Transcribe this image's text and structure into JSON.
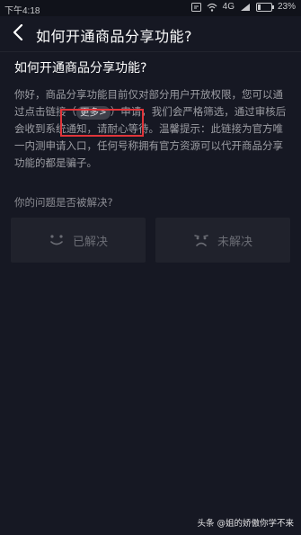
{
  "status_bar": {
    "time": "下午4:18",
    "network": "4G",
    "battery": "23%",
    "battery_level": 0.23
  },
  "header": {
    "back_icon": "chevron-left-icon",
    "title": "如何开通商品分享功能?"
  },
  "article": {
    "title": "如何开通商品分享功能?",
    "body_before_link": "你好，商品分享功能目前仅对部分用户开放权限，您可以通过点击链接（",
    "link_label": "更多>",
    "body_after_link": "）申请，我们会严格筛选，通过审核后会收到系统通知，请耐心等待。温馨提示：此链接为官方唯一内测申请入口，任何号称拥有官方资源可以代开商品分享功能的都是骗子。"
  },
  "feedback": {
    "question": "你的问题是否被解决?",
    "resolved_label": "已解决",
    "resolved_icon": "smile-icon",
    "unresolved_label": "未解决",
    "unresolved_icon": "frown-icon"
  },
  "colors": {
    "background": "#161823",
    "highlight_box": "#e0353a"
  },
  "watermark": "头条 @姐的娇傲你学不来"
}
